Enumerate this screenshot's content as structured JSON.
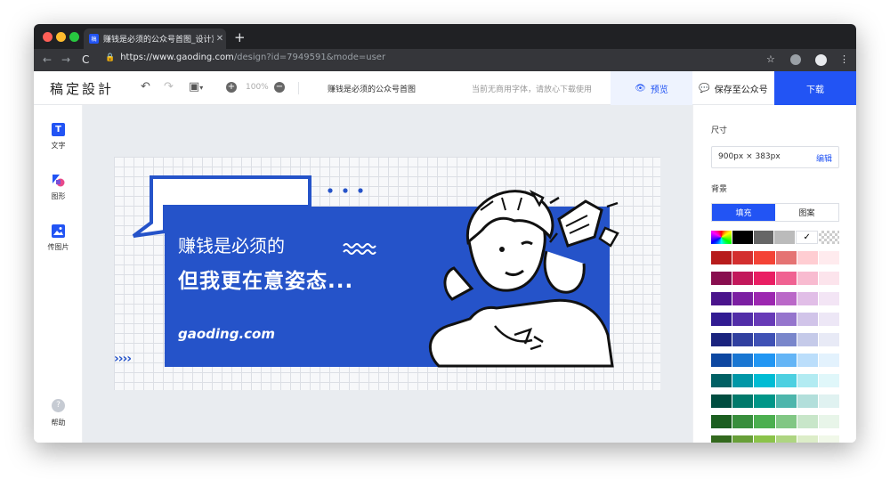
{
  "browser": {
    "tab_title": "赚钱是必须的公众号首图_设计》",
    "tab_favicon_text": "稿",
    "url_host": "https://www.gaoding.com",
    "url_path": "/design?id=7949591&mode=user"
  },
  "toolbar": {
    "logo": "稿定設計",
    "zoom": "100%",
    "doc_name": "赚钱是必须的公众号首图",
    "font_notice": "当前无商用字体，请放心下载使用",
    "preview_label": "预览",
    "wechat_label": "保存至公众号",
    "download_label": "下载"
  },
  "sidebar": {
    "items": [
      {
        "label": "文字",
        "icon": "text-icon"
      },
      {
        "label": "图形",
        "icon": "shapes-icon"
      },
      {
        "label": "传图片",
        "icon": "image-upload-icon"
      }
    ],
    "help_label": "帮助"
  },
  "artboard": {
    "line1": "赚钱是必须的",
    "line2": "但我更在意姿态...",
    "site": "gaoding.com",
    "arrows": "››››"
  },
  "panel": {
    "size_label": "尺寸",
    "size_value": "900px × 383px",
    "edit_label": "编辑",
    "bg_label": "背景",
    "tab_fill": "填充",
    "tab_pattern": "图案",
    "top_swatches": [
      "rainbow",
      "#000000",
      "#666666",
      "#bbbbbb",
      "#ffffff",
      "transparent"
    ],
    "swatch_rows": [
      [
        "#b71c1c",
        "#d32f2f",
        "#f44336",
        "#e57373",
        "#ffcdd2",
        "#ffebee"
      ],
      [
        "#880e4f",
        "#c2185b",
        "#e91e63",
        "#f06292",
        "#f8bbd0",
        "#fce4ec"
      ],
      [
        "#4a148c",
        "#7b1fa2",
        "#9c27b0",
        "#ba68c8",
        "#e1bee7",
        "#f3e5f5"
      ],
      [
        "#311b92",
        "#512da8",
        "#673ab7",
        "#9575cd",
        "#d1c4e9",
        "#ede7f6"
      ],
      [
        "#1a237e",
        "#303f9f",
        "#3f51b5",
        "#7986cb",
        "#c5cae9",
        "#e8eaf6"
      ],
      [
        "#0d47a1",
        "#1976d2",
        "#2196f3",
        "#64b5f6",
        "#bbdefb",
        "#e3f2fd"
      ],
      [
        "#006064",
        "#0097a7",
        "#00bcd4",
        "#4dd0e1",
        "#b2ebf2",
        "#e0f7fa"
      ],
      [
        "#004d40",
        "#00796b",
        "#009688",
        "#4db6ac",
        "#b2dfdb",
        "#e0f2f1"
      ],
      [
        "#1b5e20",
        "#388e3c",
        "#4caf50",
        "#81c784",
        "#c8e6c9",
        "#e8f5e9"
      ],
      [
        "#33691e",
        "#689f38",
        "#8bc34a",
        "#aed581",
        "#dcedc8",
        "#f1f8e9"
      ]
    ]
  }
}
